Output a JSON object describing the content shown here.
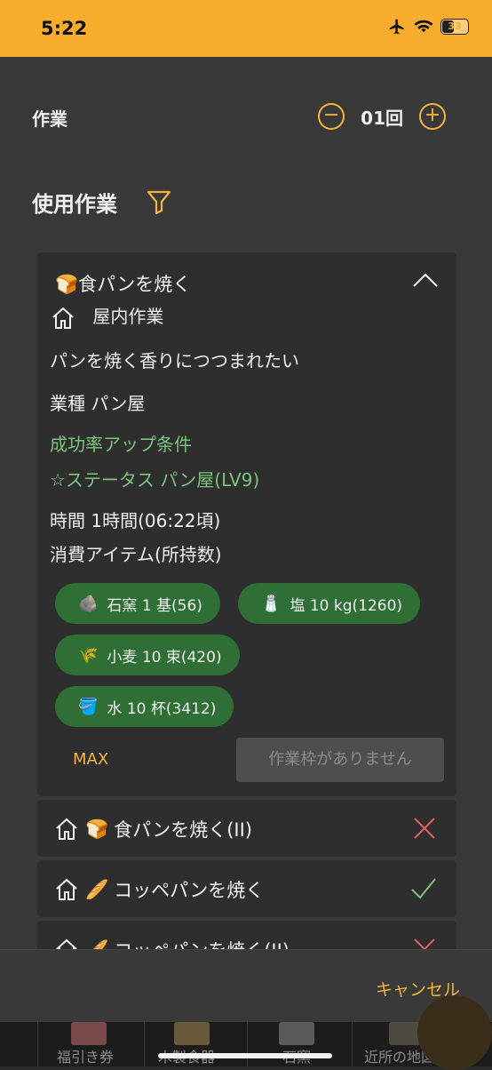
{
  "status": {
    "time": "5:22",
    "battery": "33"
  },
  "work": {
    "label": "作業",
    "count": "01回",
    "minus": "−",
    "plus": "+"
  },
  "section": {
    "title": "使用作業"
  },
  "recipe": {
    "title": "🍞食パンを焼く",
    "location": "屋内作業",
    "description": "パンを焼く香りにつつまれたい",
    "industry": "業種 パン屋",
    "bonus_heading": "成功率アップ条件",
    "bonus_condition": "☆ステータス パン屋(LV9)",
    "time": "時間 1時間(06:22頃)",
    "items_heading": "消費アイテム(所持数)",
    "items": [
      {
        "icon": "🪨",
        "label": "石窯 1 基(56)"
      },
      {
        "icon": "🧂",
        "label": "塩 10 kg(1260)"
      },
      {
        "icon": "🌾",
        "label": "小麦 10 束(420)"
      },
      {
        "icon": "🪣",
        "label": "水 10 杯(3412)"
      }
    ],
    "max_label": "MAX",
    "submit_label": "作業枠がありません"
  },
  "recipe_list": [
    {
      "icon": "🍞",
      "label": "食パンを焼く(II)",
      "status": "unavailable"
    },
    {
      "icon": "🥖",
      "label": "コッペパンを焼く",
      "status": "available"
    },
    {
      "icon": "🥖",
      "label": "コッペパンを焼く(II)",
      "status": "unavailable"
    }
  ],
  "footer": {
    "cancel_label": "キャンセル"
  },
  "tabs": [
    {
      "label": "福引き券"
    },
    {
      "label": "木製食器"
    },
    {
      "label": "石窯"
    },
    {
      "label": "近所の地図"
    }
  ],
  "colors": {
    "accent": "#f4b33a",
    "status_bar": "#f9ad2e",
    "chip_green": "#2f6e34",
    "bonus_green": "#7cc47a",
    "unavailable_red": "#e06060",
    "available_green": "#7cc47a"
  }
}
